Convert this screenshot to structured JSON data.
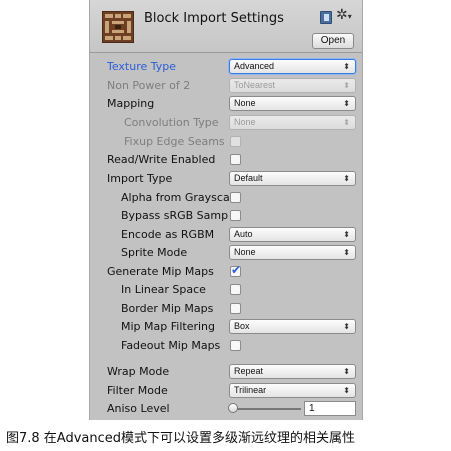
{
  "header": {
    "title": "Block Import Settings",
    "open_label": "Open"
  },
  "settings": {
    "texture_type": {
      "label": "Texture Type",
      "value": "Advanced"
    },
    "non_power_of_2": {
      "label": "Non Power of 2",
      "value": "ToNearest"
    },
    "mapping": {
      "label": "Mapping",
      "value": "None"
    },
    "convolution_type": {
      "label": "Convolution Type",
      "value": "None"
    },
    "fixup_edge_seams": {
      "label": "Fixup Edge Seams",
      "checked": false
    },
    "read_write_enabled": {
      "label": "Read/Write Enabled",
      "checked": false
    },
    "import_type": {
      "label": "Import Type",
      "value": "Default"
    },
    "alpha_from_grayscale": {
      "label": "Alpha from Graysca",
      "checked": false
    },
    "bypass_srgb": {
      "label": "Bypass sRGB Sampl",
      "checked": false
    },
    "encode_as_rgbm": {
      "label": "Encode as RGBM",
      "value": "Auto"
    },
    "sprite_mode": {
      "label": "Sprite Mode",
      "value": "None"
    },
    "generate_mip_maps": {
      "label": "Generate Mip Maps",
      "checked": true
    },
    "in_linear_space": {
      "label": "In Linear Space",
      "checked": false
    },
    "border_mip_maps": {
      "label": "Border Mip Maps",
      "checked": false
    },
    "mip_map_filtering": {
      "label": "Mip Map Filtering",
      "value": "Box"
    },
    "fadeout_mip_maps": {
      "label": "Fadeout Mip Maps",
      "checked": false
    },
    "wrap_mode": {
      "label": "Wrap Mode",
      "value": "Repeat"
    },
    "filter_mode": {
      "label": "Filter Mode",
      "value": "Trilinear"
    },
    "aniso_level": {
      "label": "Aniso Level",
      "value": "1"
    }
  },
  "icons": {
    "asset": "block-texture-icon",
    "help": "book-icon",
    "settings": "gear-icon",
    "dropdown": "dropdown-arrow-icon",
    "check": "checkmark-icon"
  },
  "colors": {
    "panel_bg": "#c2c2c2",
    "focus_blue": "#2a5fd6"
  },
  "caption": "图7.8 在Advanced模式下可以设置多级渐远纹理的相关属性"
}
